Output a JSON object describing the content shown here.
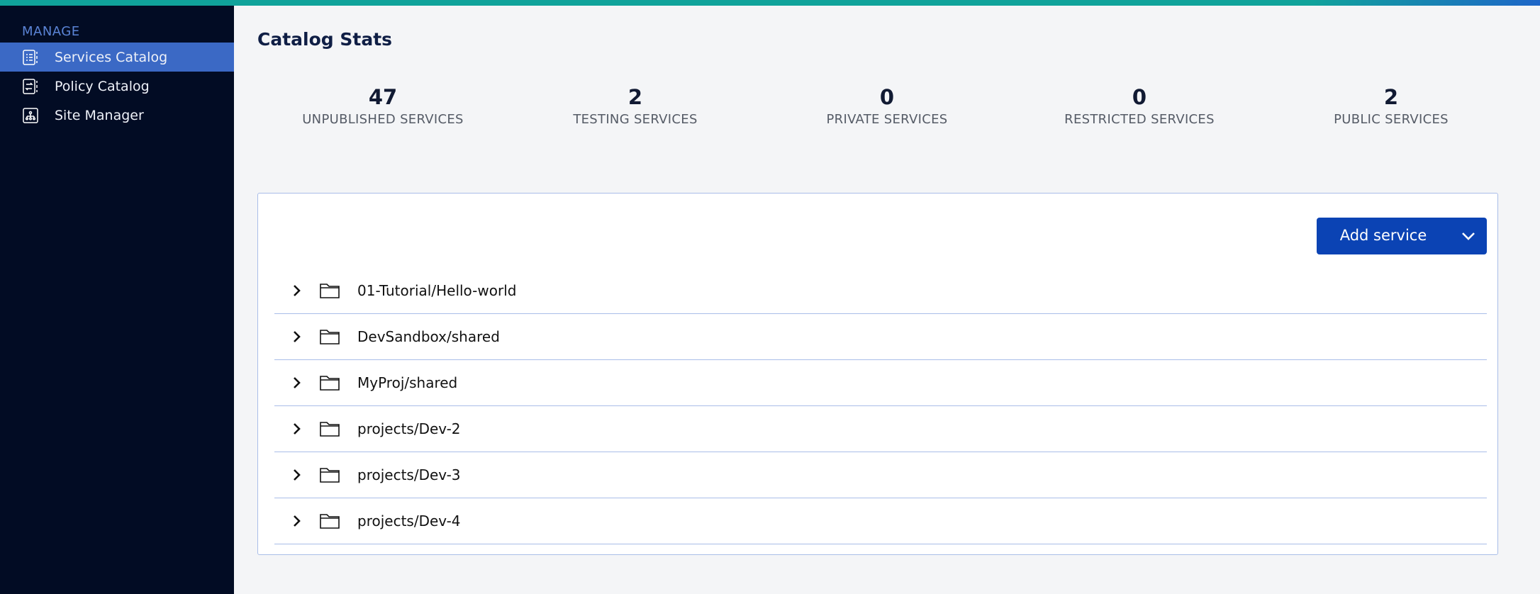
{
  "sidebar": {
    "section": "MANAGE",
    "items": [
      {
        "label": "Services Catalog",
        "icon": "services-catalog-icon",
        "active": true
      },
      {
        "label": "Policy Catalog",
        "icon": "policy-catalog-icon",
        "active": false
      },
      {
        "label": "Site Manager",
        "icon": "site-manager-icon",
        "active": false
      }
    ]
  },
  "main": {
    "title": "Catalog Stats",
    "stats": [
      {
        "value": "47",
        "label": "UNPUBLISHED SERVICES"
      },
      {
        "value": "2",
        "label": "TESTING SERVICES"
      },
      {
        "value": "0",
        "label": "PRIVATE SERVICES"
      },
      {
        "value": "0",
        "label": "RESTRICTED SERVICES"
      },
      {
        "value": "2",
        "label": "PUBLIC SERVICES"
      }
    ],
    "add_button": "Add service",
    "folders": [
      "01-Tutorial/Hello-world",
      "DevSandbox/shared",
      "MyProj/shared",
      "projects/Dev-2",
      "projects/Dev-3",
      "projects/Dev-4"
    ]
  },
  "colors": {
    "accent": "#0b43b4",
    "sidebar": "#020c24",
    "active": "#3b69c5",
    "topbar": "#10a39b"
  }
}
